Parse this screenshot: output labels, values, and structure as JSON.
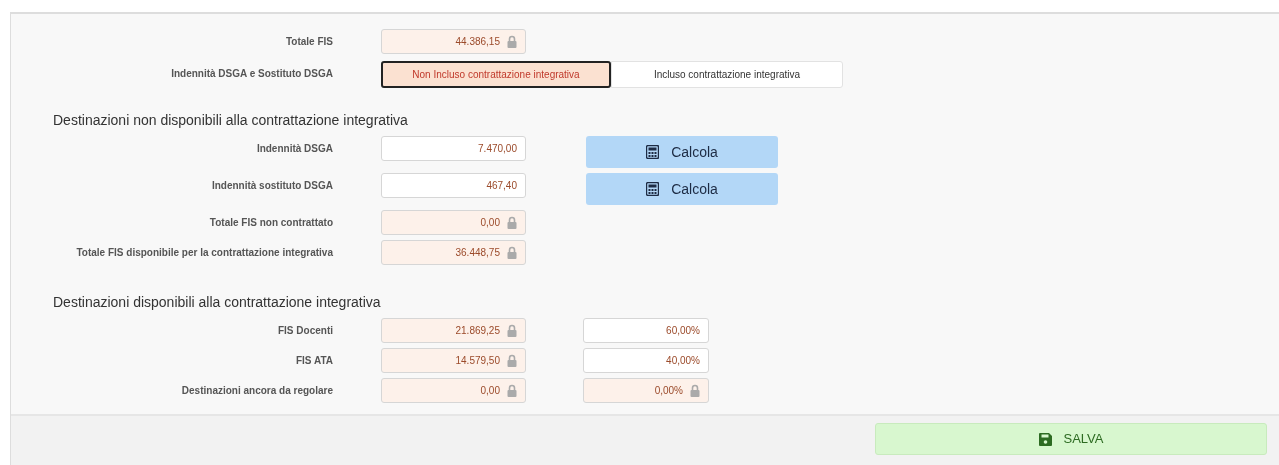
{
  "top_fields": [
    {
      "label": "Totale FIS",
      "value": "44.386,15",
      "locked": true
    }
  ],
  "toggle": {
    "label": "Indennità DSGA e Sostituto DSGA",
    "options": [
      {
        "label": "Non Incluso contrattazione integrativa",
        "selected": true
      },
      {
        "label": "Incluso contrattazione integrativa",
        "selected": false
      }
    ]
  },
  "sections": [
    {
      "title": "Destinazioni non disponibili alla contrattazione integrativa",
      "rows": [
        {
          "label": "Indennità DSGA",
          "value": "7.470,00",
          "locked": false,
          "action": "Calcola"
        },
        {
          "label": "Indennità sostituto DSGA",
          "value": "467,40",
          "locked": false,
          "action": "Calcola"
        },
        {
          "label": "Totale FIS non contrattato",
          "value": "0,00",
          "locked": true
        },
        {
          "label": "Totale FIS disponibile per la contrattazione integrativa",
          "value": "36.448,75",
          "locked": true
        }
      ]
    },
    {
      "title": "Destinazioni disponibili alla contrattazione integrativa",
      "rows": [
        {
          "label": "FIS Docenti",
          "value": "21.869,25",
          "locked": true,
          "percent": {
            "value": "60,00%",
            "locked": false
          }
        },
        {
          "label": "FIS ATA",
          "value": "14.579,50",
          "locked": true,
          "percent": {
            "value": "40,00%",
            "locked": false
          }
        },
        {
          "label": "Destinazioni ancora da regolare",
          "value": "0,00",
          "locked": true,
          "percent": {
            "value": "0,00%",
            "locked": true
          }
        }
      ]
    }
  ],
  "save_button": "SALVA"
}
